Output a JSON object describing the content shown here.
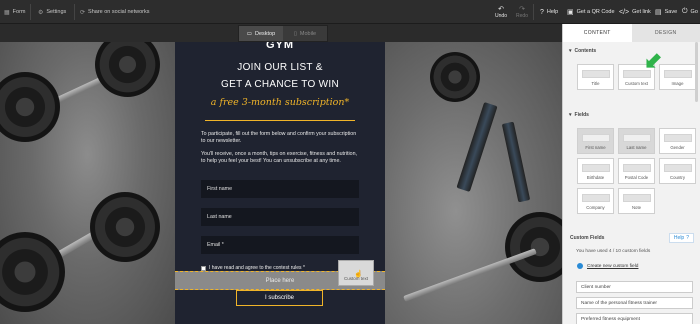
{
  "topbar": {
    "nav": [
      {
        "icon": "grid-icon",
        "label": "Form"
      },
      {
        "icon": "gear-icon",
        "label": "Settings"
      },
      {
        "icon": "share-icon",
        "label": "Share on social networks"
      }
    ],
    "undo_label": "Undo",
    "redo_label": "Redo",
    "help_label": "Help",
    "qr_label": "Get a QR Code",
    "link_label": "Get link",
    "save_label": "Save",
    "last_label": "Go"
  },
  "device": {
    "desktop": "Desktop",
    "mobile": "Mobile",
    "active": "desktop"
  },
  "form": {
    "top_text": "GYM",
    "heading1": "JOIN OUR LIST &",
    "heading2": "GET A CHANCE TO WIN",
    "script": "a free 3-month subscription*",
    "para1": "To participate, fill out the form below and confirm your subscription to our newsletter.",
    "para2": "You'll receive, once a month, tips on exercise, fitness and nutrition, to help you feel your best! You can unsubscribe at any time.",
    "fields": [
      "First name",
      "Last name",
      "Email *"
    ],
    "consent": "I have read and agree to the contest rules *",
    "drop_placeholder": "Place here",
    "drag_label": "Custom text",
    "subscribe": "I subscribe",
    "accent": "#f0b429"
  },
  "panel": {
    "tabs": [
      "CONTENT",
      "DESIGN"
    ],
    "contents_title": "Contents",
    "contents": [
      "Title",
      "Custom text",
      "Image"
    ],
    "fields_title": "Fields",
    "fields": [
      "First name",
      "Last name",
      "Gender",
      "Birthdate",
      "Postal Code",
      "Country",
      "Company",
      "Note"
    ],
    "custom_title": "Custom Fields",
    "help": "Help",
    "used": "You have used 4 / 10 custom fields",
    "create": "Create new custom field",
    "custom_fields": [
      "Client number",
      "Name of the personal fitness trainer",
      "Preferred fitness equipment"
    ]
  }
}
